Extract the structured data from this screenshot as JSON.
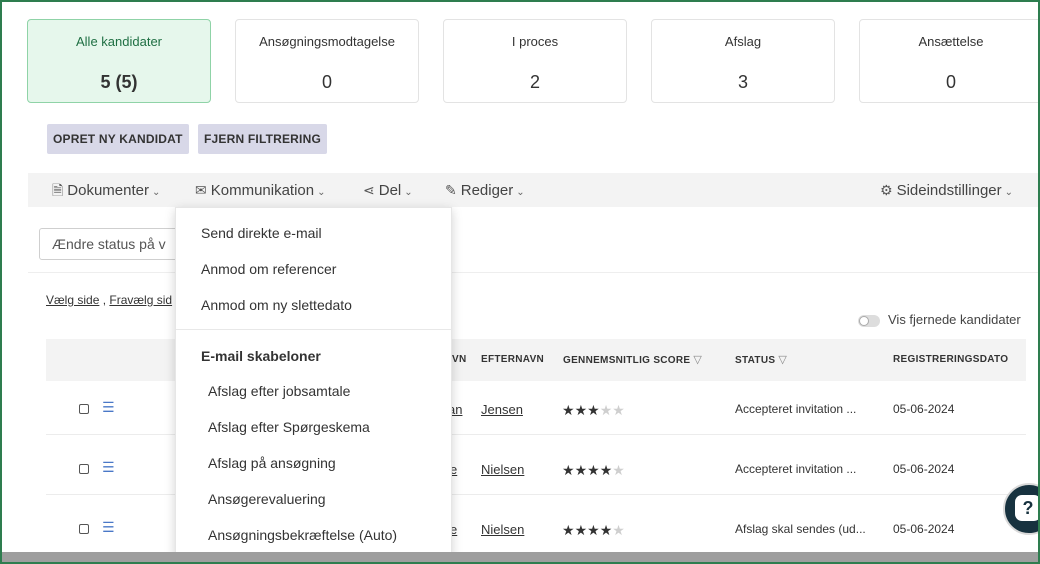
{
  "stats": [
    {
      "title": "Alle kandidater",
      "value": "5 (5)",
      "active": true
    },
    {
      "title": "Ansøgningsmodtagelse",
      "value": "0"
    },
    {
      "title": "I proces",
      "value": "2"
    },
    {
      "title": "Afslag",
      "value": "3"
    },
    {
      "title": "Ansættelse",
      "value": "0"
    }
  ],
  "actions": {
    "create_label": "OPRET NY KANDIDAT",
    "clear_filter_label": "FJERN FILTRERING"
  },
  "toolbar": {
    "documents": "Dokumenter",
    "communication": "Kommunikation",
    "share": "Del",
    "edit": "Rediger",
    "page_settings": "Sideindstillinger"
  },
  "status_select": {
    "value": "Ændre status på v"
  },
  "select_links": {
    "select_page": "Vælg side",
    "deselect_page": "Fravælg sid"
  },
  "show_removed": {
    "label": "Vis fjernede kandidater",
    "on": false
  },
  "table": {
    "headers": {
      "firstname_partial": "VN",
      "lastname": "EFTERNAVN",
      "score": "GENNEMSNITLIG SCORE",
      "status": "STATUS",
      "registered": "REGISTRERINGSDATO"
    },
    "rows": [
      {
        "first_partial": "an",
        "last": "Jensen",
        "stars": 3,
        "status": "Accepteret invitation ...",
        "date": "05-06-2024"
      },
      {
        "first_partial": "e",
        "last": "Nielsen",
        "stars": 4,
        "status": "Accepteret invitation ...",
        "date": "05-06-2024"
      },
      {
        "first_partial": "e",
        "last": "Nielsen",
        "stars": 4,
        "status": "Afslag skal sendes (ud...",
        "date": "05-06-2024"
      }
    ]
  },
  "dropdown": {
    "items": [
      "Send direkte e-mail",
      "Anmod om referencer",
      "Anmod om ny slettedato"
    ],
    "templates_heading": "E-mail skabeloner",
    "templates": [
      "Afslag efter jobsamtale",
      "Afslag efter Spørgeskema",
      "Afslag på ansøgning",
      "Ansøgerevaluering",
      "Ansøgningsbekræftelse (Auto)"
    ]
  },
  "icons": {
    "documents": "document-icon",
    "communication": "envelope-icon",
    "share": "share-icon",
    "edit": "pencil-icon",
    "settings": "gear-icon",
    "help": "help-chat-icon"
  },
  "colors": {
    "active_card_bg": "#e6f7ec",
    "active_card_text": "#1f6f43",
    "chip_bg": "#d8d8e8",
    "frame_border": "#2e7d4f",
    "row_menu_icon": "#4a78c7"
  }
}
